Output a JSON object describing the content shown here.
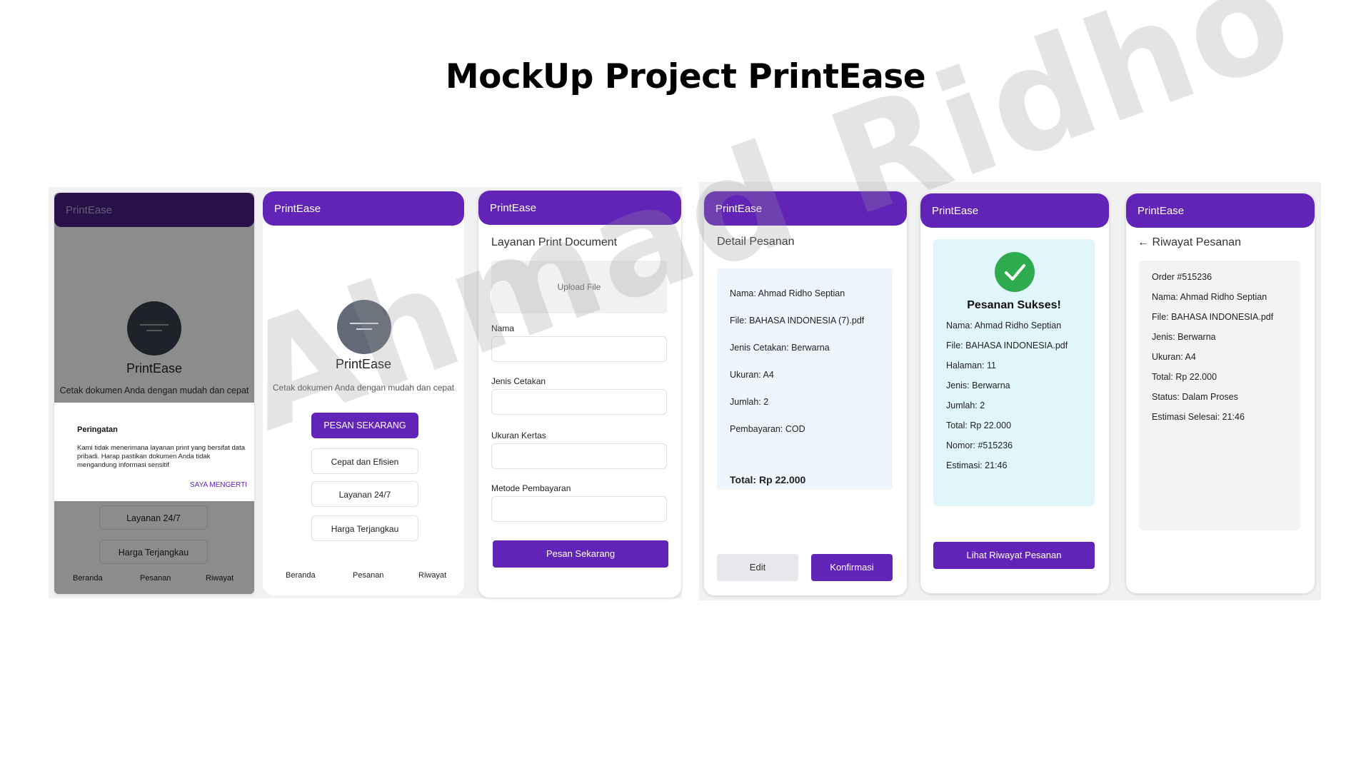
{
  "page_title": "MockUp Project PrintEase",
  "watermark": "Ahmad Ridho",
  "app_name": "PrintEase",
  "colors": {
    "primary": "#6223b8",
    "success": "#2eaa4f",
    "panel_blue": "#eef6fd",
    "panel_cyan": "#e1f6fb"
  },
  "screen1": {
    "header": "PrintEase",
    "app_name": "PrintEase",
    "tagline": "Cetak dokumen Anda dengan mudah dan cepat",
    "feature_1": "Layanan 24/7",
    "feature_2": "Harga Terjangkau",
    "dialog": {
      "title": "Peringatan",
      "body": "Kami tidak menerimana layanan print yang bersifat data pribadi. Harap pastikan dokumen Anda tidak mengandung  informasi sensitif",
      "button": "SAYA MENGERTI"
    },
    "nav": [
      "Beranda",
      "Pesanan",
      "Riwayat"
    ]
  },
  "screen2": {
    "header": "PrintEase",
    "app_name": "PrintEase",
    "tagline": "Cetak dokumen Anda dengan mudah dan cepat",
    "cta": "PESAN SEKARANG",
    "features": [
      "Cepat dan Efisien",
      "Layanan 24/7",
      "Harga Terjangkau"
    ],
    "nav": [
      "Beranda",
      "Pesanan",
      "Riwayat"
    ]
  },
  "screen3": {
    "header": "PrintEase",
    "title": "Layanan Print Document",
    "upload": "Upload File",
    "labels": [
      "Nama",
      "Jenis Cetakan",
      "Ukuran Kertas",
      "Metode Pembayaran"
    ],
    "submit": "Pesan Sekarang"
  },
  "screen4": {
    "header": "PrintEase",
    "title": "Detail Pesanan",
    "rows": [
      "Nama: Ahmad Ridho Septian",
      "File: BAHASA INDONESIA (7).pdf",
      "Jenis Cetakan: Berwarna",
      "Ukuran: A4",
      "Jumlah: 2",
      "Pembayaran: COD"
    ],
    "total": "Total: Rp 22.000",
    "edit": "Edit",
    "confirm": "Konfirmasi"
  },
  "screen5": {
    "header": "PrintEase",
    "success": "Pesanan Sukses!",
    "rows": [
      "Nama: Ahmad Ridho Septian",
      "File: BAHASA INDONESIA.pdf",
      "Halaman: 11",
      "Jenis: Berwarna",
      "Jumlah: 2",
      "Total: Rp 22.000",
      "Nomor: #515236",
      "Estimasi: 21:46"
    ],
    "button": "Lihat Riwayat Pesanan"
  },
  "screen6": {
    "header": "PrintEase",
    "title": "← Riwayat Pesanan",
    "rows": [
      "Order #515236",
      "Nama: Ahmad Ridho Septian",
      "File: BAHASA INDONESIA.pdf",
      "Jenis: Berwarna",
      "Ukuran: A4",
      "Total: Rp 22.000",
      "Status: Dalam Proses",
      "Estimasi Selesai: 21:46"
    ]
  }
}
